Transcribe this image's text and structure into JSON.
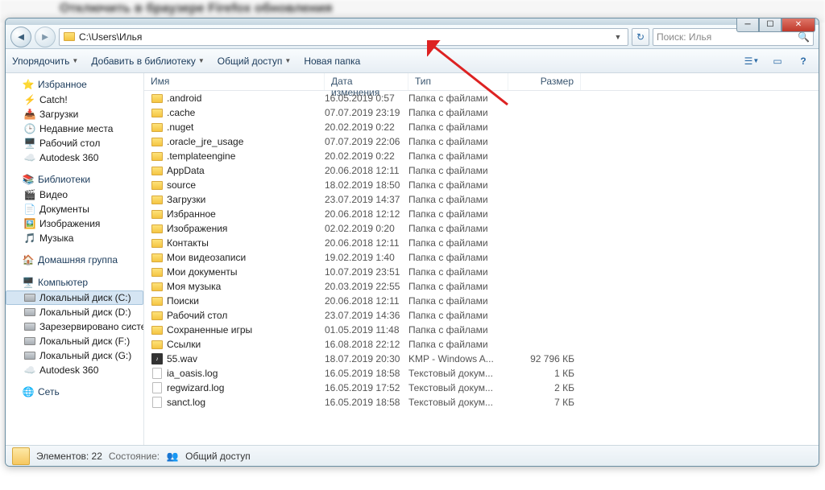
{
  "titlebar": {
    "bgtext": "Отключить в браузере Firefox обновления"
  },
  "nav": {
    "path": "C:\\Users\\Илья",
    "search_placeholder": "Поиск: Илья"
  },
  "toolbar": {
    "organize": "Упорядочить",
    "library": "Добавить в библиотеку",
    "share": "Общий доступ",
    "newfolder": "Новая папка"
  },
  "columns": {
    "name": "Имя",
    "date": "Дата изменения",
    "type": "Тип",
    "size": "Размер"
  },
  "sidebar": {
    "favorites": {
      "label": "Избранное",
      "items": [
        "Catch!",
        "Загрузки",
        "Недавние места",
        "Рабочий стол",
        "Autodesk 360"
      ]
    },
    "libraries": {
      "label": "Библиотеки",
      "items": [
        "Видео",
        "Документы",
        "Изображения",
        "Музыка"
      ]
    },
    "homegroup": {
      "label": "Домашняя группа"
    },
    "computer": {
      "label": "Компьютер",
      "items": [
        "Локальный диск (C:)",
        "Локальный диск (D:)",
        "Зарезервировано системой",
        "Локальный диск (F:)",
        "Локальный диск (G:)",
        "Autodesk 360"
      ]
    },
    "network": {
      "label": "Сеть"
    }
  },
  "files": [
    {
      "icon": "folder",
      "name": ".android",
      "date": "16.05.2019 0:57",
      "type": "Папка с файлами",
      "size": ""
    },
    {
      "icon": "folder",
      "name": ".cache",
      "date": "07.07.2019 23:19",
      "type": "Папка с файлами",
      "size": ""
    },
    {
      "icon": "folder",
      "name": ".nuget",
      "date": "20.02.2019 0:22",
      "type": "Папка с файлами",
      "size": ""
    },
    {
      "icon": "folder",
      "name": ".oracle_jre_usage",
      "date": "07.07.2019 22:06",
      "type": "Папка с файлами",
      "size": ""
    },
    {
      "icon": "folder",
      "name": ".templateengine",
      "date": "20.02.2019 0:22",
      "type": "Папка с файлами",
      "size": ""
    },
    {
      "icon": "folder",
      "name": "AppData",
      "date": "20.06.2018 12:11",
      "type": "Папка с файлами",
      "size": ""
    },
    {
      "icon": "folder",
      "name": "source",
      "date": "18.02.2019 18:50",
      "type": "Папка с файлами",
      "size": ""
    },
    {
      "icon": "folder",
      "name": "Загрузки",
      "date": "23.07.2019 14:37",
      "type": "Папка с файлами",
      "size": ""
    },
    {
      "icon": "folder",
      "name": "Избранное",
      "date": "20.06.2018 12:12",
      "type": "Папка с файлами",
      "size": ""
    },
    {
      "icon": "folder",
      "name": "Изображения",
      "date": "02.02.2019 0:20",
      "type": "Папка с файлами",
      "size": ""
    },
    {
      "icon": "folder",
      "name": "Контакты",
      "date": "20.06.2018 12:11",
      "type": "Папка с файлами",
      "size": ""
    },
    {
      "icon": "folder",
      "name": "Мои видеозаписи",
      "date": "19.02.2019 1:40",
      "type": "Папка с файлами",
      "size": ""
    },
    {
      "icon": "folder",
      "name": "Мои документы",
      "date": "10.07.2019 23:51",
      "type": "Папка с файлами",
      "size": ""
    },
    {
      "icon": "folder",
      "name": "Моя музыка",
      "date": "20.03.2019 22:55",
      "type": "Папка с файлами",
      "size": ""
    },
    {
      "icon": "folder",
      "name": "Поиски",
      "date": "20.06.2018 12:11",
      "type": "Папка с файлами",
      "size": ""
    },
    {
      "icon": "folder",
      "name": "Рабочий стол",
      "date": "23.07.2019 14:36",
      "type": "Папка с файлами",
      "size": ""
    },
    {
      "icon": "folder",
      "name": "Сохраненные игры",
      "date": "01.05.2019 11:48",
      "type": "Папка с файлами",
      "size": ""
    },
    {
      "icon": "folder",
      "name": "Ссылки",
      "date": "16.08.2018 22:12",
      "type": "Папка с файлами",
      "size": ""
    },
    {
      "icon": "wav",
      "name": "55.wav",
      "date": "18.07.2019 20:30",
      "type": "KMP - Windows A...",
      "size": "92 796 КБ"
    },
    {
      "icon": "txt",
      "name": "ia_oasis.log",
      "date": "16.05.2019 18:58",
      "type": "Текстовый докум...",
      "size": "1 КБ"
    },
    {
      "icon": "txt",
      "name": "regwizard.log",
      "date": "16.05.2019 17:52",
      "type": "Текстовый докум...",
      "size": "2 КБ"
    },
    {
      "icon": "txt",
      "name": "sanct.log",
      "date": "16.05.2019 18:58",
      "type": "Текстовый докум...",
      "size": "7 КБ"
    }
  ],
  "status": {
    "count_label": "Элементов: 22",
    "state_label": "Состояние:",
    "shared": "Общий доступ"
  }
}
